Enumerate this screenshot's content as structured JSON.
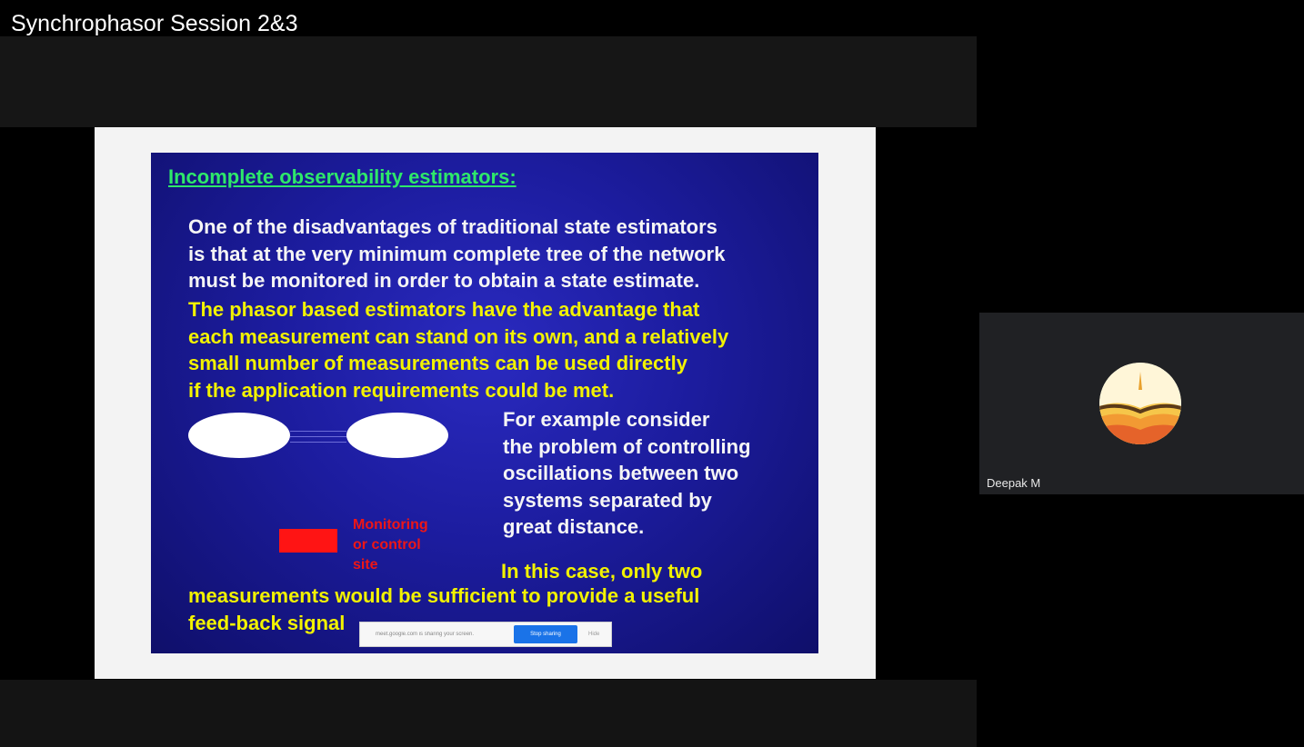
{
  "video": {
    "title": "Synchrophasor Session 2&3"
  },
  "slide": {
    "heading": "Incomplete observability estimators:",
    "paragraph1": [
      "One of the disadvantages of traditional state estimators",
      "is that at the very minimum complete tree of the network",
      "must be monitored in order to obtain a state estimate."
    ],
    "paragraph2": [
      "The phasor based estimators have the advantage that",
      "each measurement can stand on its own, and a relatively",
      "small number of measurements can be used directly",
      "if the application requirements could be met."
    ],
    "example": [
      "For example consider",
      "the problem of controlling",
      "oscillations between two",
      "systems separated by",
      "great distance."
    ],
    "conclusion_line1": "In this case, only two",
    "conclusion_line2": [
      "measurements would be sufficient to provide a useful",
      "feed-back signal"
    ],
    "legend_label": [
      "Monitoring",
      "or control",
      "site"
    ],
    "colors": {
      "heading": "#2ee86a",
      "white_text": "#f5f5f5",
      "yellow_text": "#f2f200",
      "background": "#1c1c9e",
      "site_marker": "#ff1414"
    }
  },
  "share_notice": {
    "text": "meet.google.com is sharing your screen.",
    "stop_label": "Stop sharing",
    "hide_label": "Hide"
  },
  "participant": {
    "name": "Deepak M",
    "avatar_icon": "sunset-avatar-icon"
  }
}
